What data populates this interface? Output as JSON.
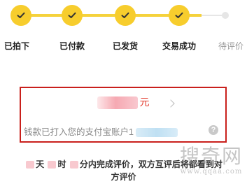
{
  "order_progress": {
    "steps": [
      {
        "label": "已拍下",
        "status": "done"
      },
      {
        "label": "已付款",
        "status": "done"
      },
      {
        "label": "已发货",
        "status": "done"
      },
      {
        "label": "交易成功",
        "status": "done"
      },
      {
        "label": "待评价",
        "status": "pending"
      }
    ],
    "colors": {
      "done": "#f7cd2d",
      "pending": "#e6e6e6"
    }
  },
  "payment_card": {
    "amount_unit": "元",
    "notice": "钱款已打入您的支付宝账户",
    "notice_account_prefix": "1"
  },
  "review_prompt": {
    "part1": "天",
    "part2": "时",
    "part3": "分内完成评价，双方互评后将都看到对",
    "part4": "方评价"
  },
  "watermark": {
    "text": "搜奇网",
    "url": "www.qqaa.com"
  },
  "accent_color": "#c9201c"
}
